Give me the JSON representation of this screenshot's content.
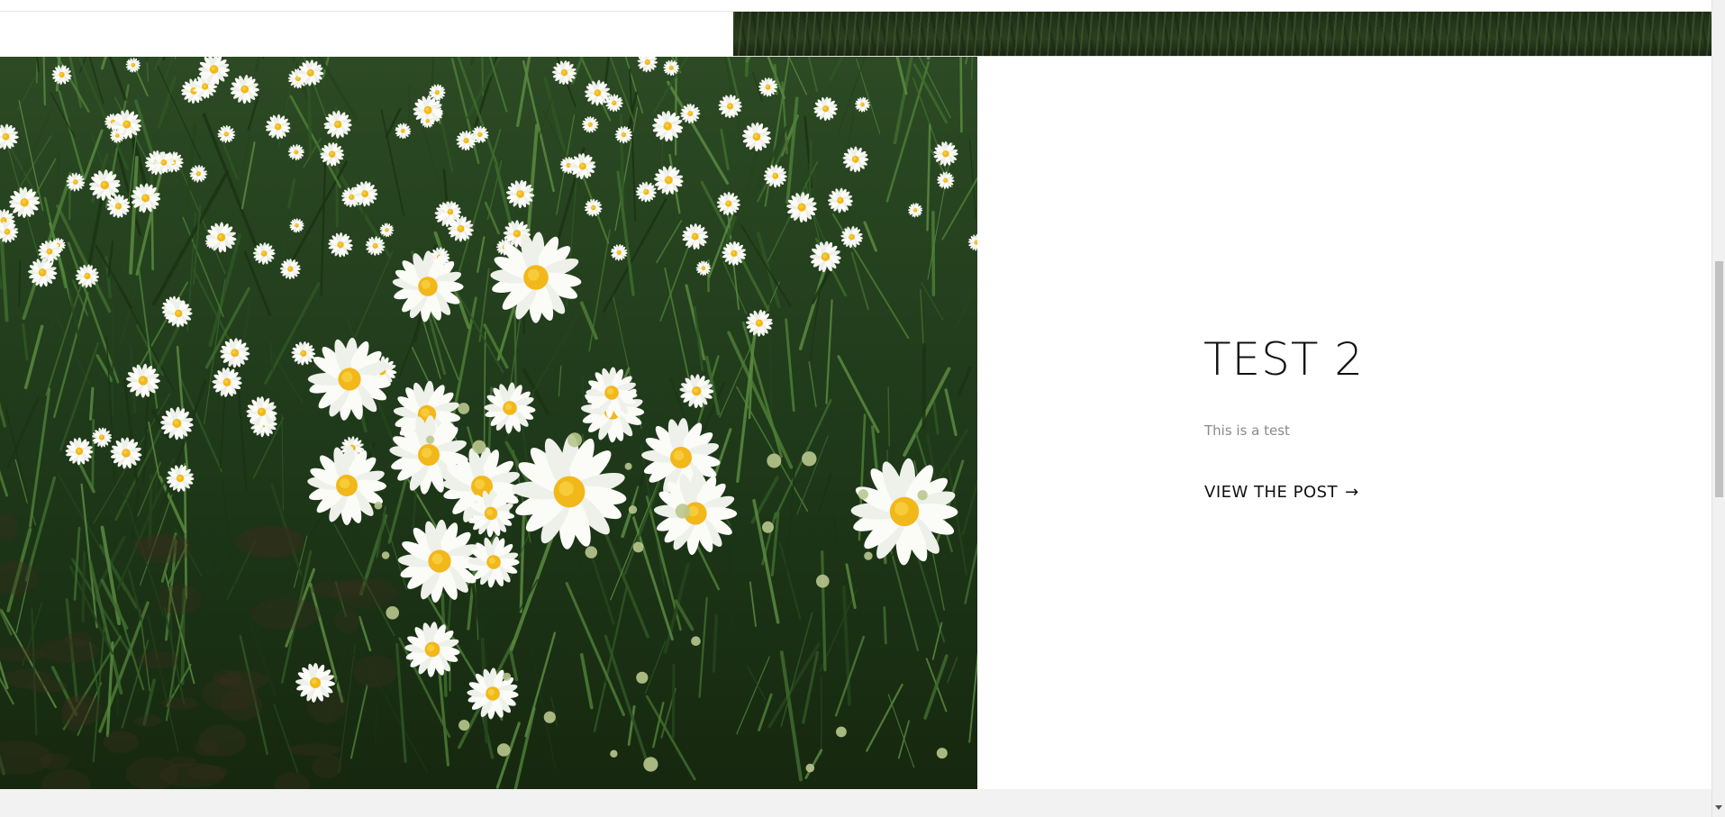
{
  "post": {
    "title": "TEST 2",
    "excerpt": "This is a test",
    "cta_label": "VIEW THE POST",
    "cta_icon": "arrow-right-icon",
    "image_subject": "daisy-field-photo"
  },
  "previous_post": {
    "image_subject": "grass-photo"
  },
  "scrollbar": {
    "arrow_icon": "chevron-down-icon"
  },
  "colors": {
    "title": "#111111",
    "excerpt": "#8a8a8a",
    "footer_strip": "#f2f2f2",
    "foliage": "#1e3318"
  }
}
